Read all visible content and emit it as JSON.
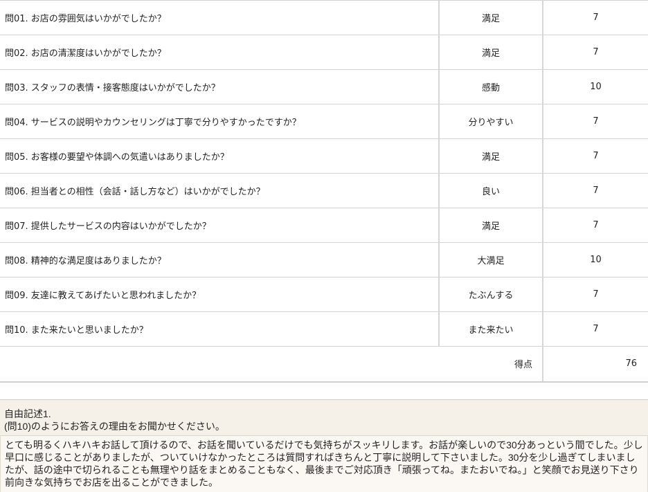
{
  "questions": [
    {
      "text": "問01.  お店の雰囲気はいかがでしたか？",
      "answer": "満足",
      "score": "7"
    },
    {
      "text": "問02.  お店の清潔度はいかがでしたか？",
      "answer": "満足",
      "score": "7"
    },
    {
      "text": "問03.  スタッフの表情・接客態度はいかがでしたか？",
      "answer": "感動",
      "score": "10"
    },
    {
      "text": "問04.  サービスの説明やカウンセリングは丁寧で分りやすかったですか？",
      "answer": "分りやすい",
      "score": "7"
    },
    {
      "text": "問05.  お客様の要望や体調への気遣いはありましたか？",
      "answer": "満足",
      "score": "7"
    },
    {
      "text": "問06.  担当者との相性（会話・話し方など）はいかがでしたか？",
      "answer": "良い",
      "score": "7"
    },
    {
      "text": "問07.  提供したサービスの内容はいかがでしたか？",
      "answer": "満足",
      "score": "7"
    },
    {
      "text": "問08.  精神的な満足度はありましたか？",
      "answer": "大満足",
      "score": "10"
    },
    {
      "text": "問09.  友達に教えてあげたいと思われましたか？",
      "answer": "たぶんする",
      "score": "7"
    },
    {
      "text": "問10.  また来たいと思いましたか？",
      "answer": "また来たい",
      "score": "7"
    }
  ],
  "total": {
    "label": "得点",
    "value": "76"
  },
  "free_comment": {
    "heading": "自由記述1.",
    "prompt": "(問10)のようにお答えの理由をお聞かせください。",
    "body": "とても明るくハキハキお話して頂けるので、お話を聞いているだけでも気持ちがスッキリします。お話が楽しいので30分あっという間でした。少し早口に感じることがありましたが、ついていけなかったところは質問すればきちんと丁寧に説明して下さいました。30分を少し過ぎてしまいましたが、話の途中で切られることも無理やり話をまとめることもなく、最後までご対応頂き「頑張ってね。またおいでね。」と笑顔でお見送り下さり前向きな気持ちでお店を出ることができました。"
  }
}
